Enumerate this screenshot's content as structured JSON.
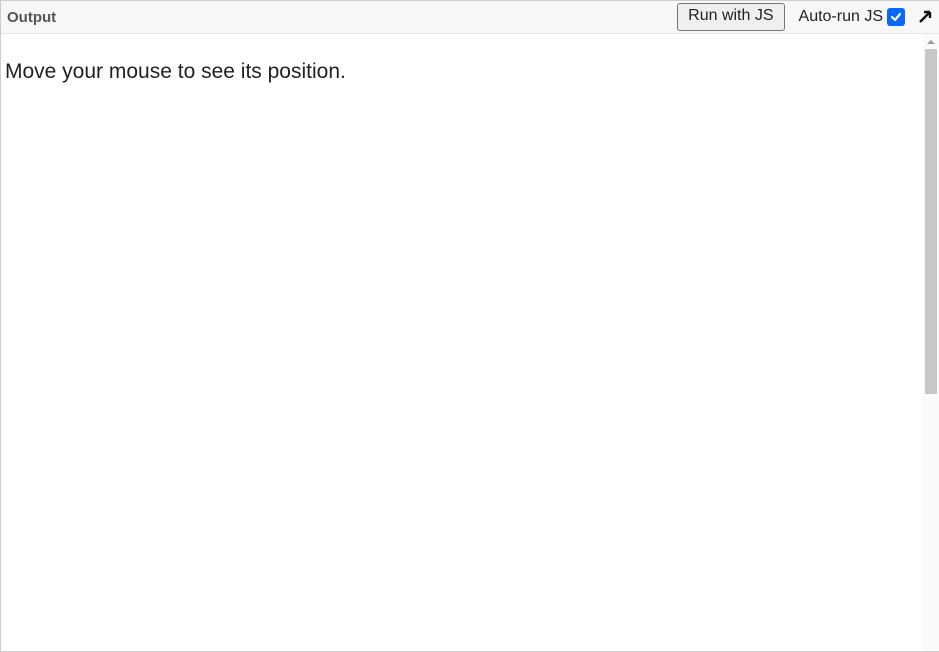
{
  "header": {
    "title": "Output",
    "run_label": "Run with JS",
    "autorun_label": "Auto-run JS",
    "autorun_checked": true
  },
  "content": {
    "message": "Move your mouse to see its position."
  }
}
